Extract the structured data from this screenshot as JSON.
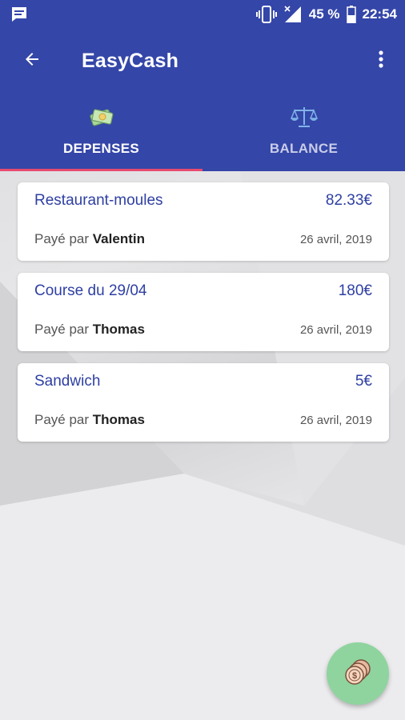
{
  "status_bar": {
    "battery_percent": "45 %",
    "time": "22:54",
    "icons": [
      "message-icon",
      "vibrate-icon",
      "no-signal-icon",
      "battery-icon"
    ]
  },
  "app_bar": {
    "title": "EasyCash",
    "icons": [
      "back-arrow-icon",
      "more-vert-icon"
    ]
  },
  "tabs": [
    {
      "label": "DEPENSES",
      "icon": "money-icon",
      "active": true
    },
    {
      "label": "BALANCE",
      "icon": "scale-icon",
      "active": false
    }
  ],
  "expenses": [
    {
      "title": "Restaurant-moules",
      "amount": "82.33€",
      "paid_prefix": "Payé par",
      "payer": "Valentin",
      "date": "26 avril, 2019"
    },
    {
      "title": "Course du 29/04",
      "amount": "180€",
      "paid_prefix": "Payé par",
      "payer": "Thomas",
      "date": "26 avril, 2019"
    },
    {
      "title": "Sandwich",
      "amount": "5€",
      "paid_prefix": "Payé par",
      "payer": "Thomas",
      "date": "26 avril, 2019"
    }
  ],
  "fab": {
    "icon": "coins-icon"
  },
  "colors": {
    "primary": "#3446a8",
    "accent_indicator": "#e84a6f",
    "title_text": "#2e3fa3",
    "fab": "#8fd49e"
  }
}
